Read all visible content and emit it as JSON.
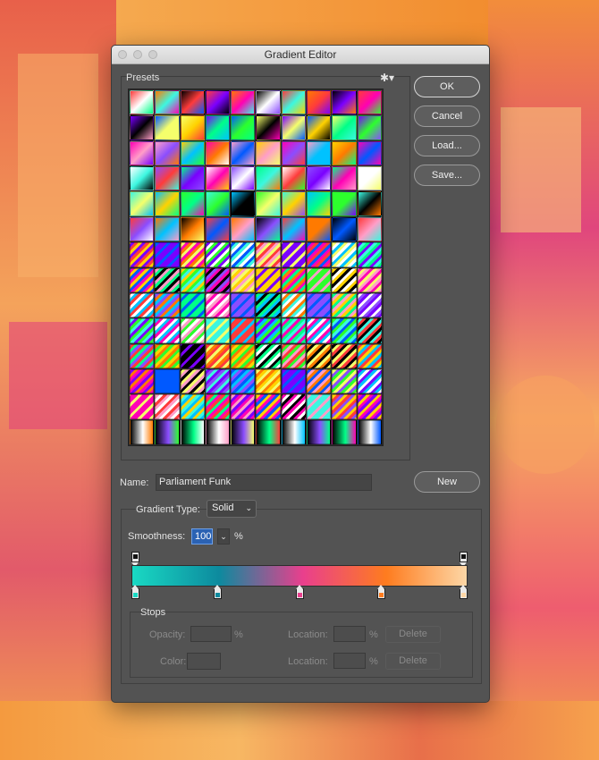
{
  "dialog": {
    "title": "Gradient Editor"
  },
  "presets": {
    "label": "Presets",
    "gear_icon": "gear-icon",
    "rows": 14,
    "cols": 10
  },
  "buttons": {
    "ok": "OK",
    "cancel": "Cancel",
    "load": "Load...",
    "save": "Save...",
    "new": "New"
  },
  "name": {
    "label": "Name:",
    "value": "Parliament Funk"
  },
  "gradient_type": {
    "label": "Gradient Type:",
    "value": "Solid"
  },
  "smoothness": {
    "label": "Smoothness:",
    "value": "100",
    "unit": "%"
  },
  "gradient": {
    "color_stops": [
      {
        "color": "#19d9c3",
        "location": 0
      },
      {
        "color": "#0d8a9e",
        "location": 25
      },
      {
        "color": "#e93f8d",
        "location": 50
      },
      {
        "color": "#fe7c1f",
        "location": 75
      },
      {
        "color": "#fdd7a6",
        "location": 100
      }
    ],
    "opacity_stops": [
      {
        "opacity": 100,
        "location": 0
      },
      {
        "opacity": 100,
        "location": 100
      }
    ]
  },
  "stops": {
    "label": "Stops",
    "opacity_label": "Opacity:",
    "color_label": "Color:",
    "location_label": "Location:",
    "percent": "%",
    "delete_label": "Delete"
  }
}
